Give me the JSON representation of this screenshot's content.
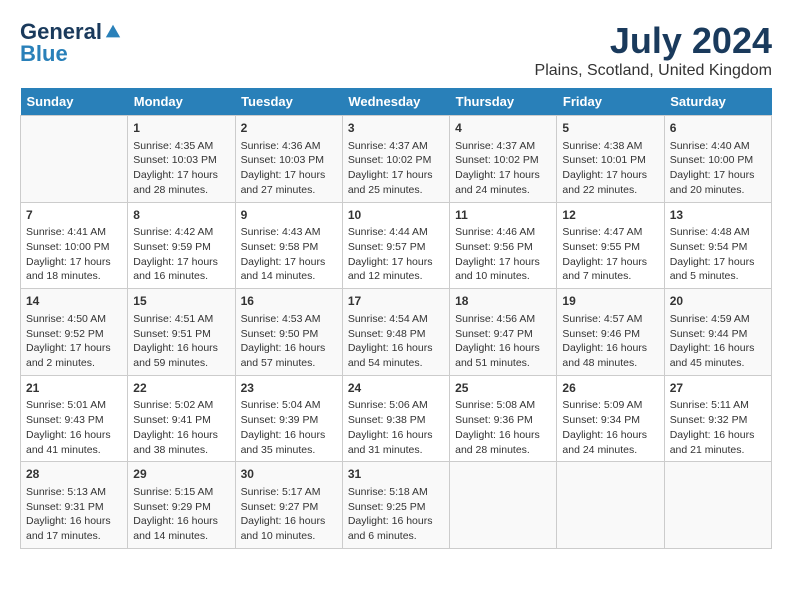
{
  "logo": {
    "general": "General",
    "blue": "Blue"
  },
  "title": {
    "month_year": "July 2024",
    "location": "Plains, Scotland, United Kingdom"
  },
  "days_of_week": [
    "Sunday",
    "Monday",
    "Tuesday",
    "Wednesday",
    "Thursday",
    "Friday",
    "Saturday"
  ],
  "weeks": [
    [
      {
        "day": "",
        "content": ""
      },
      {
        "day": "1",
        "content": "Sunrise: 4:35 AM\nSunset: 10:03 PM\nDaylight: 17 hours and 28 minutes."
      },
      {
        "day": "2",
        "content": "Sunrise: 4:36 AM\nSunset: 10:03 PM\nDaylight: 17 hours and 27 minutes."
      },
      {
        "day": "3",
        "content": "Sunrise: 4:37 AM\nSunset: 10:02 PM\nDaylight: 17 hours and 25 minutes."
      },
      {
        "day": "4",
        "content": "Sunrise: 4:37 AM\nSunset: 10:02 PM\nDaylight: 17 hours and 24 minutes."
      },
      {
        "day": "5",
        "content": "Sunrise: 4:38 AM\nSunset: 10:01 PM\nDaylight: 17 hours and 22 minutes."
      },
      {
        "day": "6",
        "content": "Sunrise: 4:40 AM\nSunset: 10:00 PM\nDaylight: 17 hours and 20 minutes."
      }
    ],
    [
      {
        "day": "7",
        "content": "Sunrise: 4:41 AM\nSunset: 10:00 PM\nDaylight: 17 hours and 18 minutes."
      },
      {
        "day": "8",
        "content": "Sunrise: 4:42 AM\nSunset: 9:59 PM\nDaylight: 17 hours and 16 minutes."
      },
      {
        "day": "9",
        "content": "Sunrise: 4:43 AM\nSunset: 9:58 PM\nDaylight: 17 hours and 14 minutes."
      },
      {
        "day": "10",
        "content": "Sunrise: 4:44 AM\nSunset: 9:57 PM\nDaylight: 17 hours and 12 minutes."
      },
      {
        "day": "11",
        "content": "Sunrise: 4:46 AM\nSunset: 9:56 PM\nDaylight: 17 hours and 10 minutes."
      },
      {
        "day": "12",
        "content": "Sunrise: 4:47 AM\nSunset: 9:55 PM\nDaylight: 17 hours and 7 minutes."
      },
      {
        "day": "13",
        "content": "Sunrise: 4:48 AM\nSunset: 9:54 PM\nDaylight: 17 hours and 5 minutes."
      }
    ],
    [
      {
        "day": "14",
        "content": "Sunrise: 4:50 AM\nSunset: 9:52 PM\nDaylight: 17 hours and 2 minutes."
      },
      {
        "day": "15",
        "content": "Sunrise: 4:51 AM\nSunset: 9:51 PM\nDaylight: 16 hours and 59 minutes."
      },
      {
        "day": "16",
        "content": "Sunrise: 4:53 AM\nSunset: 9:50 PM\nDaylight: 16 hours and 57 minutes."
      },
      {
        "day": "17",
        "content": "Sunrise: 4:54 AM\nSunset: 9:48 PM\nDaylight: 16 hours and 54 minutes."
      },
      {
        "day": "18",
        "content": "Sunrise: 4:56 AM\nSunset: 9:47 PM\nDaylight: 16 hours and 51 minutes."
      },
      {
        "day": "19",
        "content": "Sunrise: 4:57 AM\nSunset: 9:46 PM\nDaylight: 16 hours and 48 minutes."
      },
      {
        "day": "20",
        "content": "Sunrise: 4:59 AM\nSunset: 9:44 PM\nDaylight: 16 hours and 45 minutes."
      }
    ],
    [
      {
        "day": "21",
        "content": "Sunrise: 5:01 AM\nSunset: 9:43 PM\nDaylight: 16 hours and 41 minutes."
      },
      {
        "day": "22",
        "content": "Sunrise: 5:02 AM\nSunset: 9:41 PM\nDaylight: 16 hours and 38 minutes."
      },
      {
        "day": "23",
        "content": "Sunrise: 5:04 AM\nSunset: 9:39 PM\nDaylight: 16 hours and 35 minutes."
      },
      {
        "day": "24",
        "content": "Sunrise: 5:06 AM\nSunset: 9:38 PM\nDaylight: 16 hours and 31 minutes."
      },
      {
        "day": "25",
        "content": "Sunrise: 5:08 AM\nSunset: 9:36 PM\nDaylight: 16 hours and 28 minutes."
      },
      {
        "day": "26",
        "content": "Sunrise: 5:09 AM\nSunset: 9:34 PM\nDaylight: 16 hours and 24 minutes."
      },
      {
        "day": "27",
        "content": "Sunrise: 5:11 AM\nSunset: 9:32 PM\nDaylight: 16 hours and 21 minutes."
      }
    ],
    [
      {
        "day": "28",
        "content": "Sunrise: 5:13 AM\nSunset: 9:31 PM\nDaylight: 16 hours and 17 minutes."
      },
      {
        "day": "29",
        "content": "Sunrise: 5:15 AM\nSunset: 9:29 PM\nDaylight: 16 hours and 14 minutes."
      },
      {
        "day": "30",
        "content": "Sunrise: 5:17 AM\nSunset: 9:27 PM\nDaylight: 16 hours and 10 minutes."
      },
      {
        "day": "31",
        "content": "Sunrise: 5:18 AM\nSunset: 9:25 PM\nDaylight: 16 hours and 6 minutes."
      },
      {
        "day": "",
        "content": ""
      },
      {
        "day": "",
        "content": ""
      },
      {
        "day": "",
        "content": ""
      }
    ]
  ]
}
